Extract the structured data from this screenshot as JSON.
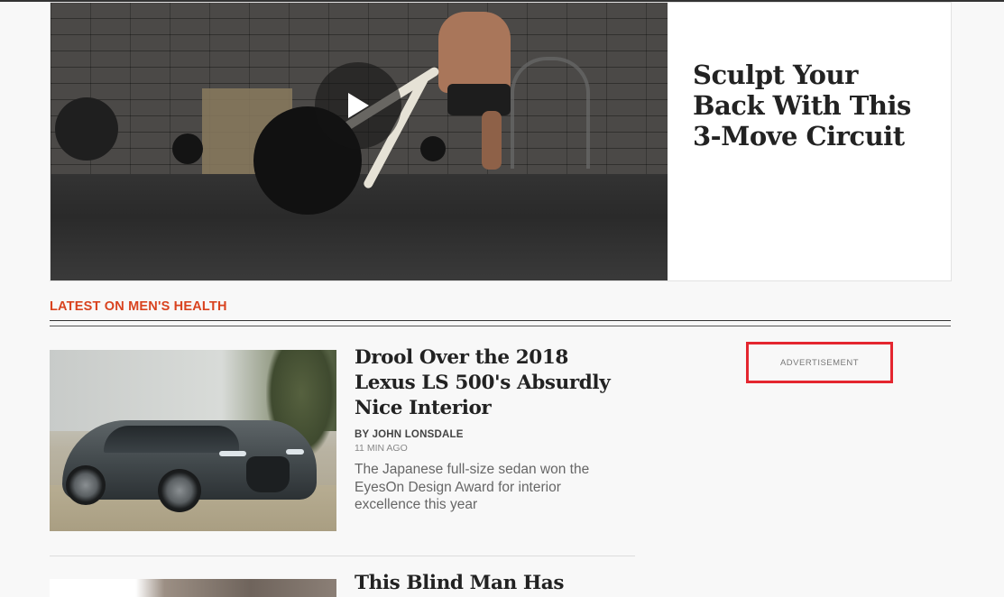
{
  "hero": {
    "title": "Sculpt Your Back With This 3-Move Circuit",
    "media_kind": "video",
    "play_icon": "play-icon"
  },
  "section": {
    "title": "LATEST ON MEN'S HEALTH"
  },
  "articles": [
    {
      "title": "Drool Over the 2018 Lexus LS 500's Absurdly Nice Interior",
      "byline": "BY JOHN LONSDALE",
      "timestamp": "11 MIN AGO",
      "dek": "The Japanese full-size sedan won the EyesOn Design Award for interior excellence this year"
    },
    {
      "title": "This Blind Man Has"
    }
  ],
  "ad": {
    "label": "ADVERTISEMENT",
    "border_color": "#e4262f"
  },
  "colors": {
    "accent": "#d9431f",
    "page_background": "#f8f8f8"
  }
}
